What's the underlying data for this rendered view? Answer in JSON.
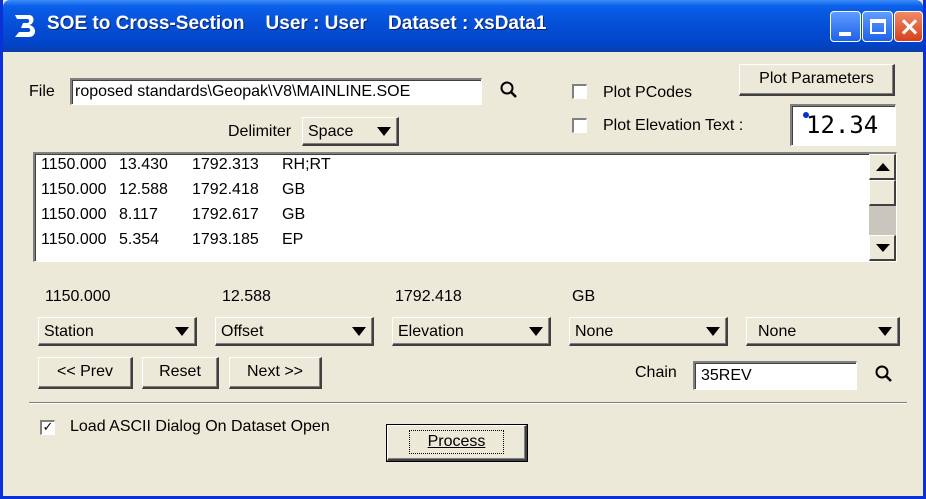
{
  "window": {
    "title": "SOE to Cross-Section    User : User    Dataset : xsData1",
    "app_icon": "bentley-b-icon",
    "accent_color": "#0a5fe8"
  },
  "file": {
    "label": "File",
    "value": "roposed standards\\Geopak\\V8\\MAINLINE.SOE",
    "browse_icon": "magnifier-icon"
  },
  "options": {
    "plot_pcodes_label": "Plot PCodes",
    "plot_pcodes_checked": false,
    "plot_elev_text_label": "Plot Elevation Text :",
    "plot_elev_text_checked": false,
    "plot_parameters_label": "Plot Parameters",
    "text_preview": "12.34"
  },
  "delimiter": {
    "label": "Delimiter",
    "value": "Space"
  },
  "list": {
    "rows": [
      [
        "1150.000",
        "13.430",
        "1792.313",
        "RH;RT"
      ],
      [
        "1150.000",
        "12.588",
        "1792.418",
        "GB"
      ],
      [
        "1150.000",
        "8.117",
        "1792.617",
        "GB"
      ],
      [
        "1150.000",
        "5.354",
        "1793.185",
        "EP"
      ]
    ]
  },
  "current": {
    "values": [
      "1150.000",
      "12.588",
      "1792.418",
      "GB"
    ]
  },
  "columns": {
    "selects": [
      "Station",
      "Offset",
      "Elevation",
      "None",
      "None"
    ]
  },
  "nav": {
    "prev": "<< Prev",
    "reset": "Reset",
    "next": "Next >>"
  },
  "chain": {
    "label": "Chain",
    "value": "35REV"
  },
  "load_ascii": {
    "label": "Load ASCII Dialog On Dataset Open",
    "checked": true
  },
  "process": {
    "label": "Process"
  }
}
